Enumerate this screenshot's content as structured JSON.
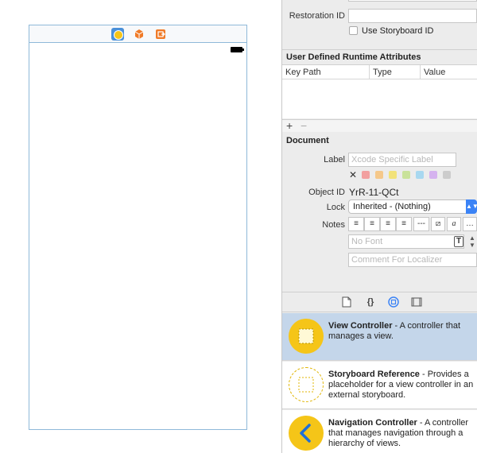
{
  "canvas": {
    "scene_dock": {
      "items": [
        "view-controller-icon",
        "first-responder-icon",
        "exit-icon"
      ]
    }
  },
  "identity": {
    "restoration_id_label": "Restoration ID",
    "restoration_id_value": "",
    "use_storyboard_id_label": "Use Storyboard ID",
    "use_storyboard_id_checked": false
  },
  "udra": {
    "header": "User Defined Runtime Attributes",
    "columns": [
      "Key Path",
      "Type",
      "Value"
    ],
    "add_label": "+",
    "remove_label": "−"
  },
  "document": {
    "header": "Document",
    "label_label": "Label",
    "label_placeholder": "Xcode Specific Label",
    "clear_symbol": "✕",
    "swatch_colors": [
      "#f2a0a0",
      "#f5c88a",
      "#f2e27a",
      "#c9e29a",
      "#a8d8f0",
      "#d5b2ef",
      "#cccccc"
    ],
    "object_id_label": "Object ID",
    "object_id_value": "YrR-11-QCt",
    "lock_label": "Lock",
    "lock_value": "Inherited - (Nothing)",
    "notes_label": "Notes",
    "notes_buttons": [
      "≡",
      "≡",
      "≡",
      "≡",
      "---",
      "⧄",
      "a",
      "…"
    ],
    "font_placeholder": "No Font",
    "font_button": "T",
    "comment_placeholder": "Comment For Localizer"
  },
  "library_tabs": [
    "file-icon",
    "braces-icon",
    "object-icon",
    "media-icon"
  ],
  "library": [
    {
      "title": "View Controller",
      "description": " - A controller that manages a view.",
      "selected": true
    },
    {
      "title": "Storyboard Reference",
      "description": " - Provides a placeholder for a view controller in an external storyboard.",
      "selected": false
    },
    {
      "title": "Navigation Controller",
      "description": " - A controller that manages navigation through a hierarchy of views.",
      "selected": false
    }
  ],
  "colors": {
    "accent": "#3b83f6",
    "selection": "#c4d6ea",
    "scene_border": "#8fb9d9",
    "vc_yellow": "#f5c518",
    "orange": "#f07b28"
  }
}
